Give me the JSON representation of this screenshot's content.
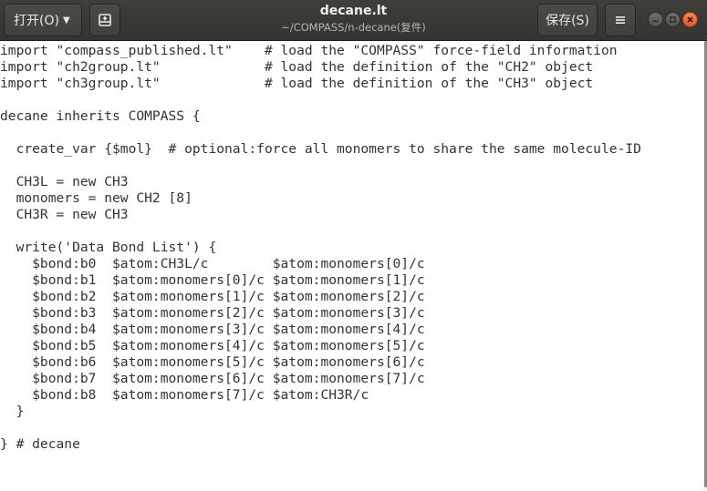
{
  "header": {
    "open_label": "打开(O)",
    "save_label": "保存(S)",
    "title": "decane.lt",
    "subtitle": "~/COMPASS/n-decane(复件)"
  },
  "icons": {
    "new_tab": "new-document-icon",
    "menu": "hamburger-menu-icon",
    "minimize": "minimize-icon",
    "maximize": "maximize-icon",
    "close": "close-icon"
  },
  "editor": {
    "lines": [
      "import \"compass_published.lt\"    # load the \"COMPASS\" force-field information",
      "import \"ch2group.lt\"             # load the definition of the \"CH2\" object",
      "import \"ch3group.lt\"             # load the definition of the \"CH3\" object",
      "",
      "decane inherits COMPASS {",
      "",
      "  create_var {$mol}  # optional:force all monomers to share the same molecule-ID",
      "",
      "  CH3L = new CH3",
      "  monomers = new CH2 [8]",
      "  CH3R = new CH3",
      "",
      "  write('Data Bond List') {",
      "    $bond:b0  $atom:CH3L/c        $atom:monomers[0]/c",
      "    $bond:b1  $atom:monomers[0]/c $atom:monomers[1]/c",
      "    $bond:b2  $atom:monomers[1]/c $atom:monomers[2]/c",
      "    $bond:b3  $atom:monomers[2]/c $atom:monomers[3]/c",
      "    $bond:b4  $atom:monomers[3]/c $atom:monomers[4]/c",
      "    $bond:b5  $atom:monomers[4]/c $atom:monomers[5]/c",
      "    $bond:b6  $atom:monomers[5]/c $atom:monomers[6]/c",
      "    $bond:b7  $atom:monomers[6]/c $atom:monomers[7]/c",
      "    $bond:b8  $atom:monomers[7]/c $atom:CH3R/c",
      "  }",
      "",
      "} # decane"
    ]
  }
}
